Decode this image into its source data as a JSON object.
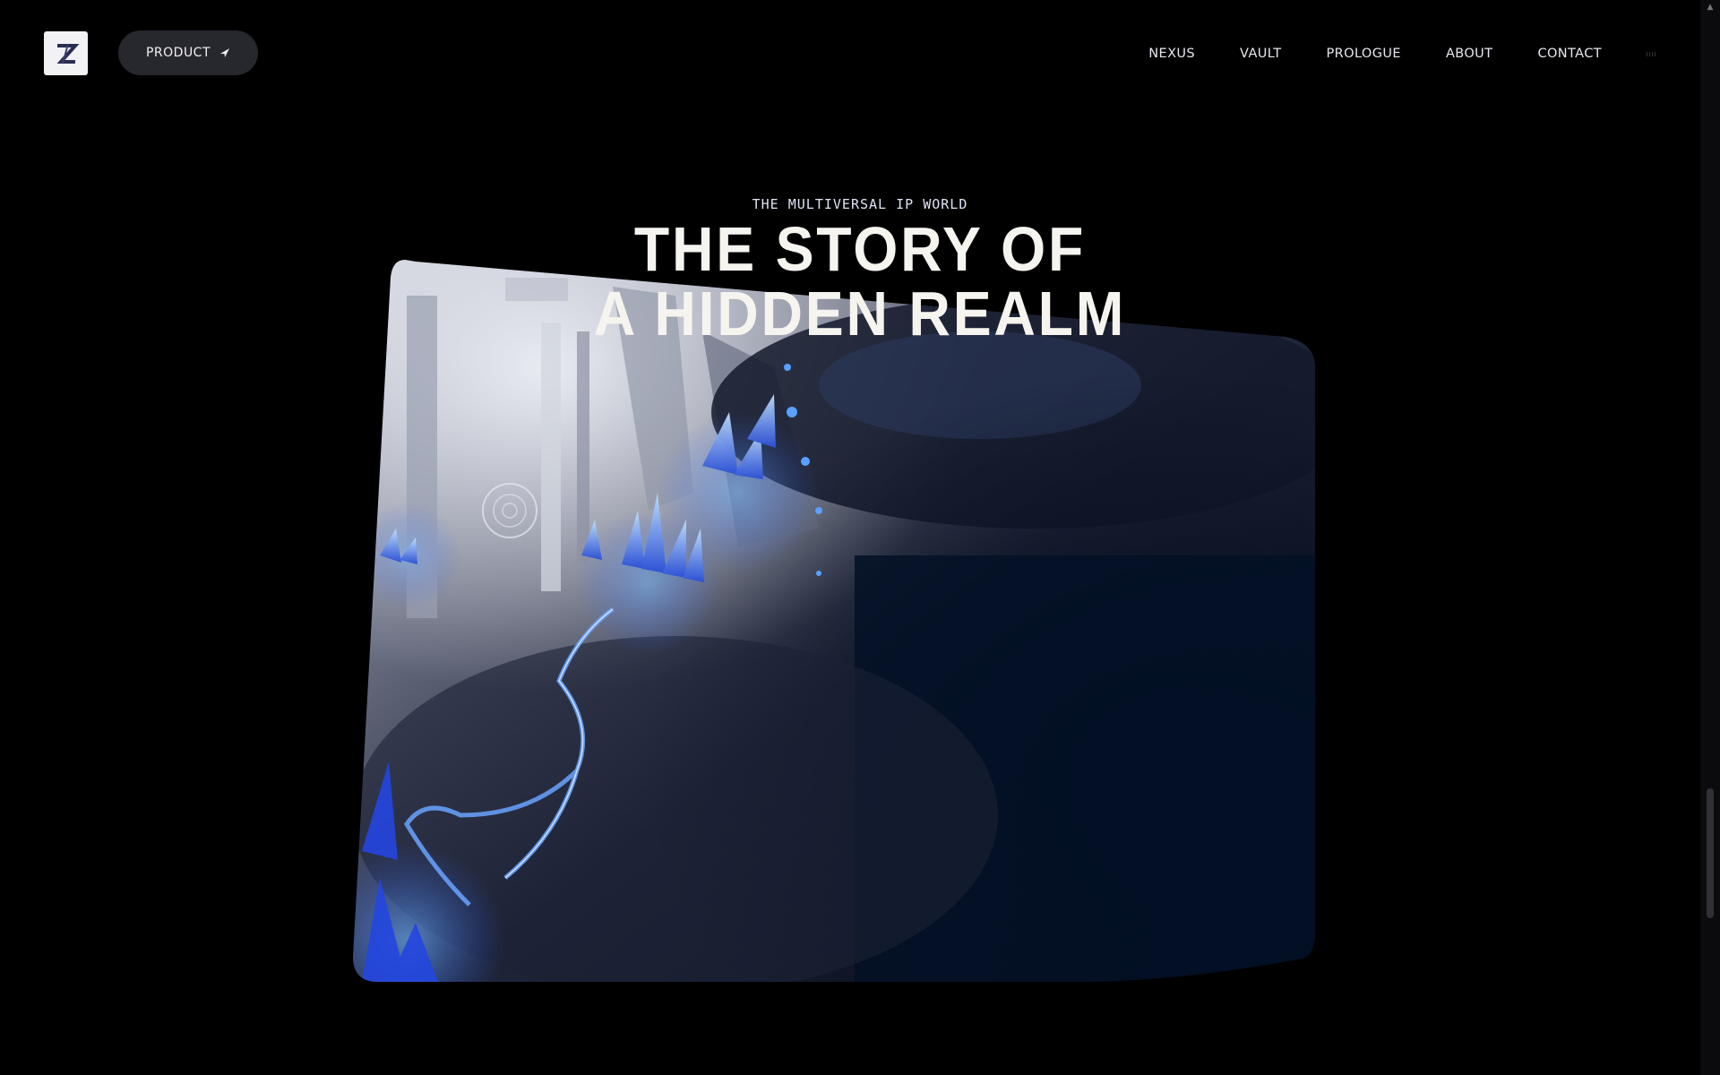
{
  "header": {
    "logo_letter": "Z",
    "product_label": "PRODUCT",
    "nav": [
      "NEXUS",
      "VAULT",
      "PROLOGUE",
      "ABOUT",
      "CONTACT"
    ]
  },
  "hero": {
    "eyebrow": "THE MULTIVERSAL IP WORLD",
    "title_line1": "THE STORY OF",
    "title_line2": "A HIDDEN REALM"
  },
  "colors": {
    "background": "#000000",
    "button_bg": "#27272e",
    "crystal_blue": "#2f5cff",
    "title": "#f6f4ef"
  },
  "icons": [
    "logo-icon",
    "arrow-icon",
    "scroll-up-icon"
  ]
}
